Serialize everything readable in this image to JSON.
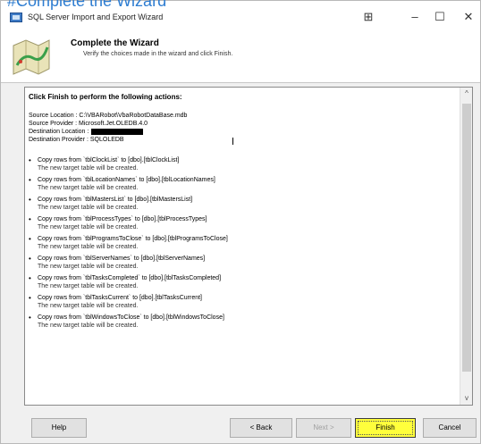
{
  "overlay_caption": "#Complete the Wizard",
  "window": {
    "title": "SQL Server Import and Export Wizard",
    "controls": {
      "layout": "⊞",
      "minimize": "–",
      "maximize": "☐",
      "close": "✕"
    }
  },
  "header": {
    "title": "Complete the Wizard",
    "subtitle": "Verify the choices made in the wizard and click Finish."
  },
  "panel": {
    "heading": "Click Finish to perform the following actions:",
    "info": [
      "Source Location : C:\\VBARobot\\VbaRobotDataBase.mdb",
      "Source Provider : Microsoft.Jet.OLEDB.4.0",
      "Destination Location :",
      "Destination Provider : SQLOLEDB"
    ],
    "bullet_char": "•",
    "actions": [
      {
        "line": "Copy rows from `tblClockList` to [dbo].[tblClockList]",
        "note": "The new target table will be created."
      },
      {
        "line": "Copy rows from `tblLocationNames` to [dbo].[tblLocationNames]",
        "note": "The new target table will be created."
      },
      {
        "line": "Copy rows from `tblMastersList` to [dbo].[tblMastersList]",
        "note": "The new target table will be created."
      },
      {
        "line": "Copy rows from `tblProcessTypes` to [dbo].[tblProcessTypes]",
        "note": "The new target table will be created."
      },
      {
        "line": "Copy rows from `tblProgramsToClose` to [dbo].[tblProgramsToClose]",
        "note": "The new target table will be created."
      },
      {
        "line": "Copy rows from `tblServerNames` to [dbo].[tblServerNames]",
        "note": "The new target table will be created."
      },
      {
        "line": "Copy rows from `tblTasksCompleted` to [dbo].[tblTasksCompleted]",
        "note": "The new target table will be created."
      },
      {
        "line": "Copy rows from `tblTasksCurrent` to [dbo].[tblTasksCurrent]",
        "note": "The new target table will be created."
      },
      {
        "line": "Copy rows from `tblWindowsToClose` to [dbo].[tblWindowsToClose]",
        "note": "The new target table will be created."
      }
    ],
    "scroll_up": "^",
    "scroll_down": "v"
  },
  "buttons": {
    "help": "Help",
    "back": "< Back",
    "next": "Next >",
    "finish": "Finish",
    "cancel": "Cancel"
  },
  "colors": {
    "finish_highlight": "#ffff3c",
    "caption": "#2e7dd1"
  },
  "icons": {
    "app": "database-window-icon",
    "wizard": "wizard-map-icon"
  }
}
